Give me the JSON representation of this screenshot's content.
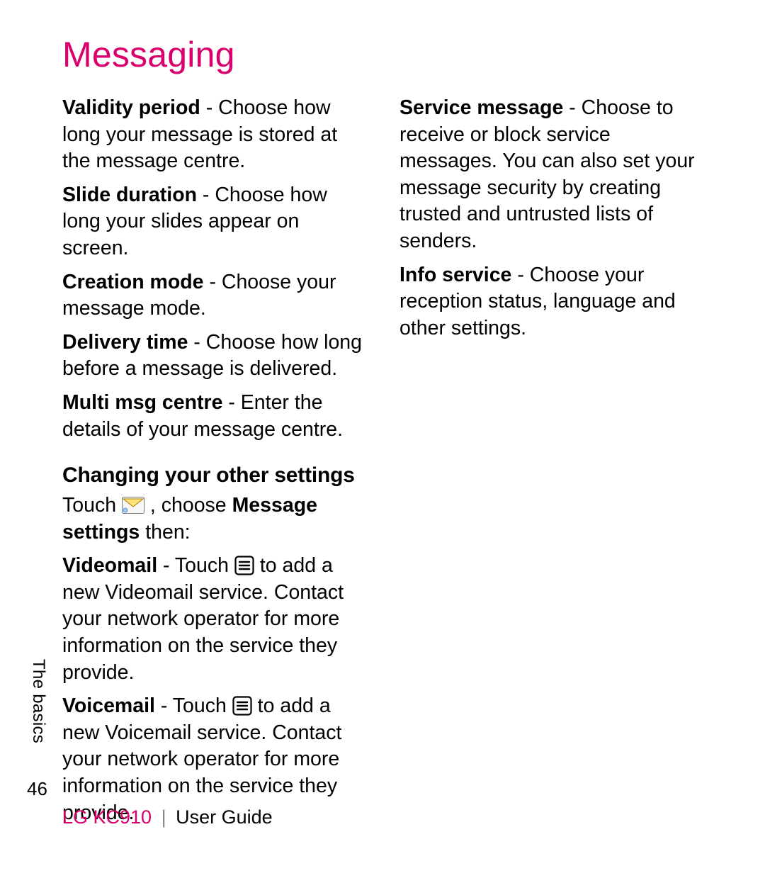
{
  "title": "Messaging",
  "side_tab": "The basics",
  "page_number": "46",
  "footer": {
    "model": "LG KC910",
    "separator": "|",
    "guide": "User Guide"
  },
  "left": {
    "items": [
      {
        "term": "Validity period",
        "desc": " - Choose how long your message is stored at the message centre."
      },
      {
        "term": "Slide duration",
        "desc": " - Choose how long your slides appear on screen."
      },
      {
        "term": "Creation mode",
        "desc": " - Choose your message mode."
      },
      {
        "term": "Delivery time",
        "desc": " - Choose how long before a message is delivered."
      },
      {
        "term": "Multi msg centre",
        "desc": " - Enter the details of your message centre."
      }
    ],
    "subhead": "Changing your other settings",
    "touch_line": {
      "pre": "Touch ",
      "mid": " , choose ",
      "bold1": "Message settings",
      "post": " then:"
    },
    "videomail": {
      "term": "Videomail",
      "pre": " - Touch ",
      "post": " to add a new Videomail service. Contact your network operator for more information on the service they provide."
    },
    "voicemail": {
      "term": "Voicemail",
      "pre": " - Touch ",
      "post": " to add a new Voicemail service. Contact your network operator for more information on the service they provide."
    }
  },
  "right": {
    "items": [
      {
        "term": "Service message",
        "desc": " - Choose to receive or block service messages. You can also set your message security by creating trusted and untrusted lists of senders."
      },
      {
        "term": "Info service",
        "desc": " - Choose your reception status, language and other settings."
      }
    ]
  }
}
